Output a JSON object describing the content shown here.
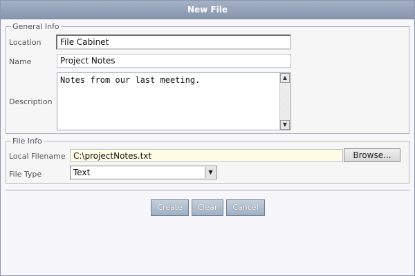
{
  "dialog": {
    "title": "New File"
  },
  "general_info": {
    "legend": "General Info",
    "location_label": "Location",
    "location_value": "File Cabinet",
    "name_label": "Name",
    "name_value": "Project Notes",
    "description_label": "Description",
    "description_value": "Notes from our last meeting."
  },
  "file_info": {
    "legend": "File Info",
    "local_filename_label": "Local Filename",
    "local_filename_value": "C:\\projectNotes.txt",
    "browse_label": "Browse...",
    "file_type_label": "File Type",
    "file_type_value": "Text"
  },
  "actions": {
    "create_label": "Create",
    "clear_label": "Clear",
    "cancel_label": "Cancel"
  },
  "icons": {
    "scroll_up": "scroll-up-arrow-icon",
    "scroll_down": "scroll-down-arrow-icon",
    "dropdown": "chevron-down-icon"
  },
  "colors": {
    "titlebar": "#8f9cb3",
    "button": "#a9b9cb",
    "filename_field": "#fffde6"
  }
}
